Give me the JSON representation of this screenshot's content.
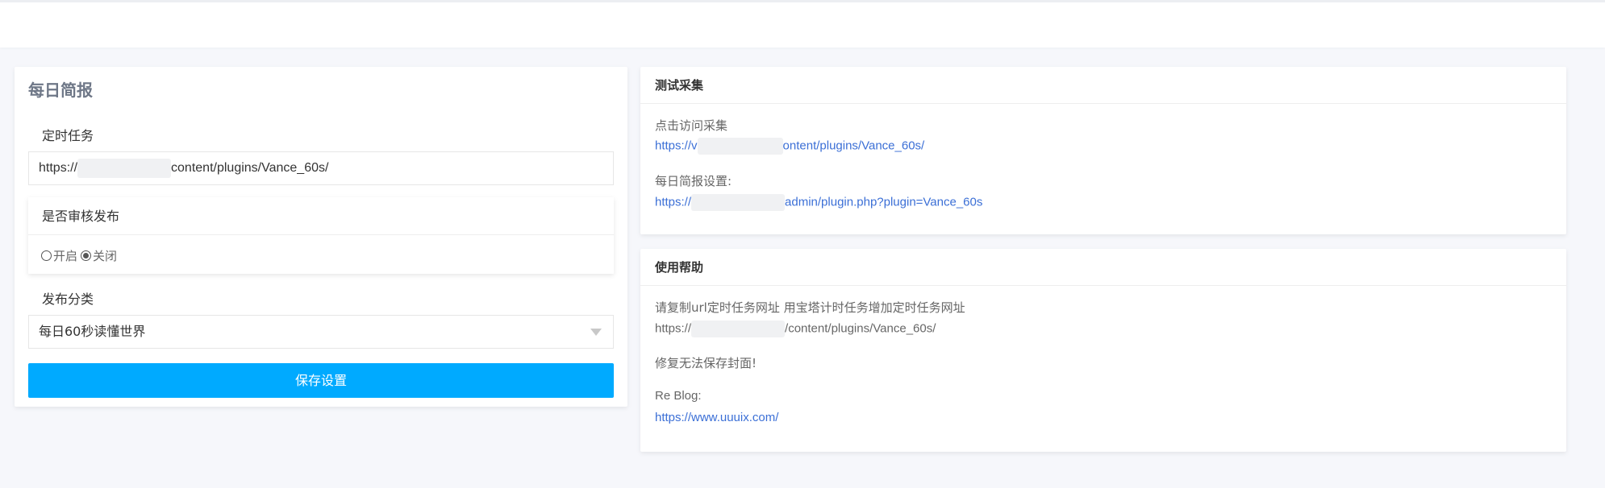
{
  "left": {
    "title": "每日简报",
    "cron_label": "定时任务",
    "cron_prefix": "https://",
    "cron_suffix": "content/plugins/Vance_60s/",
    "review_label": "是否审核发布",
    "radio_on": "开启",
    "radio_off": "关闭",
    "category_label": "发布分类",
    "category_selected": "每日60秒读懂世界",
    "save_label": "保存设置"
  },
  "collect": {
    "title": "测试采集",
    "visit_label": "点击访问采集",
    "visit_prefix": "https://v",
    "visit_suffix": "ontent/plugins/Vance_60s/",
    "settings_label": "每日简报设置:",
    "settings_prefix": "https://",
    "settings_suffix": "admin/plugin.php?plugin=Vance_60s"
  },
  "help": {
    "title": "使用帮助",
    "instruction": "请复制url定时任务网址 用宝塔计时任务增加定时任务网址",
    "url_prefix": "https://",
    "url_suffix": "/content/plugins/Vance_60s/",
    "fix_note": "修复无法保存封面!",
    "blog_label": "Re Blog:",
    "blog_url": "https://www.uuuix.com/"
  },
  "colors": {
    "accent": "#00aaff",
    "link": "#3b6fd6",
    "background": "#f6f7fb"
  }
}
